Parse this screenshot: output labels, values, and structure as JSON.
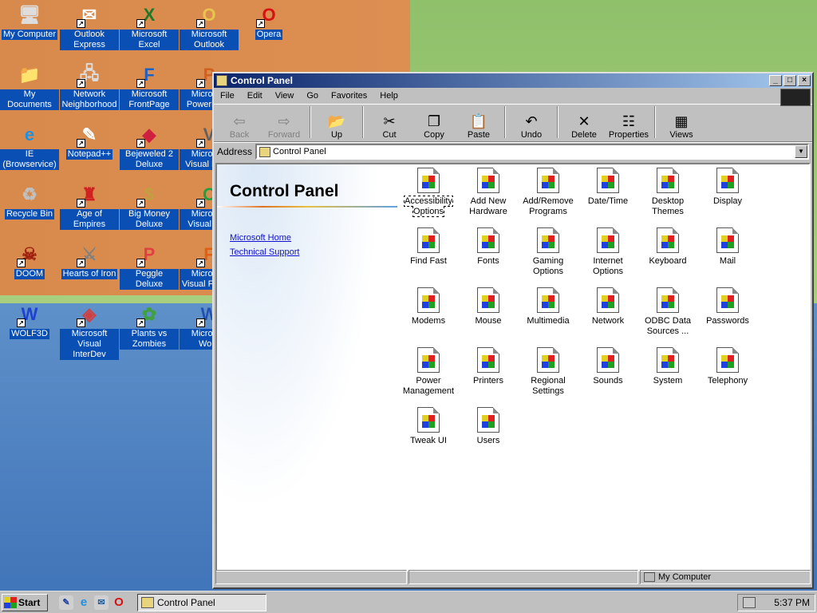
{
  "desktop": {
    "icons": [
      {
        "label": "My Computer",
        "glyph": "🖥",
        "color": "#dddddd"
      },
      {
        "label": "Outlook Express",
        "glyph": "✉",
        "color": "#ffffff"
      },
      {
        "label": "Microsoft Excel",
        "glyph": "X",
        "color": "#1e7a2a"
      },
      {
        "label": "Microsoft Outlook",
        "glyph": "O",
        "color": "#e8c44c"
      },
      {
        "label": "Opera",
        "glyph": "O",
        "color": "#d81010"
      },
      {
        "label": "My Documents",
        "glyph": "📁",
        "color": "#f0d060"
      },
      {
        "label": "Network Neighborhood",
        "glyph": "🖧",
        "color": "#dddddd"
      },
      {
        "label": "Microsoft FrontPage",
        "glyph": "F",
        "color": "#2060c0"
      },
      {
        "label": "Microsoft PowerPoint",
        "glyph": "P",
        "color": "#d06020"
      },
      {
        "label": "IE (Browservice)",
        "glyph": "e",
        "color": "#2090e0"
      },
      {
        "label": "Notepad++",
        "glyph": "✎",
        "color": "#ffffff"
      },
      {
        "label": "Bejeweled 2 Deluxe",
        "glyph": "◆",
        "color": "#d02040"
      },
      {
        "label": "Microsoft Visual Basic",
        "glyph": "V",
        "color": "#606060"
      },
      {
        "label": "Recycle Bin",
        "glyph": "♻",
        "color": "#c0c0c0"
      },
      {
        "label": "Age of Empires",
        "glyph": "♜",
        "color": "#d02020"
      },
      {
        "label": "Big Money Deluxe",
        "glyph": "$",
        "color": "#c0a040"
      },
      {
        "label": "Microsoft Visual C++",
        "glyph": "C",
        "color": "#20a040"
      },
      {
        "label": "DOOM",
        "glyph": "☠",
        "color": "#a02010"
      },
      {
        "label": "Hearts of Iron",
        "glyph": "⚔",
        "color": "#808080"
      },
      {
        "label": "Peggle Deluxe",
        "glyph": "P",
        "color": "#e04040"
      },
      {
        "label": "Microsoft Visual FoxPro",
        "glyph": "F",
        "color": "#e06010"
      },
      {
        "label": "WOLF3D",
        "glyph": "W",
        "color": "#2040d0"
      },
      {
        "label": "Microsoft Visual InterDev",
        "glyph": "◈",
        "color": "#d04040"
      },
      {
        "label": "Plants vs Zombies",
        "glyph": "✿",
        "color": "#40a040"
      },
      {
        "label": "Microsoft Word",
        "glyph": "W",
        "color": "#2050b0"
      }
    ]
  },
  "window": {
    "title": "Control Panel",
    "menu": [
      "File",
      "Edit",
      "View",
      "Go",
      "Favorites",
      "Help"
    ],
    "toolbar": [
      {
        "label": "Back",
        "glyph": "⇦",
        "disabled": true
      },
      {
        "label": "Forward",
        "glyph": "⇨",
        "disabled": true
      },
      {
        "label": "Up",
        "glyph": "📂",
        "disabled": false
      },
      {
        "label": "Cut",
        "glyph": "✂",
        "disabled": false
      },
      {
        "label": "Copy",
        "glyph": "❐",
        "disabled": false
      },
      {
        "label": "Paste",
        "glyph": "📋",
        "disabled": false
      },
      {
        "label": "Undo",
        "glyph": "↶",
        "disabled": false
      },
      {
        "label": "Delete",
        "glyph": "✕",
        "disabled": false
      },
      {
        "label": "Properties",
        "glyph": "☷",
        "disabled": false
      },
      {
        "label": "Views",
        "glyph": "▦",
        "disabled": false
      }
    ],
    "address_label": "Address",
    "address_value": "Control Panel",
    "left_title": "Control Panel",
    "links": [
      "Microsoft Home",
      "Technical Support"
    ],
    "items": [
      "Accessibility Options",
      "Add New Hardware",
      "Add/Remove Programs",
      "Date/Time",
      "Desktop Themes",
      "Display",
      "Find Fast",
      "Fonts",
      "Gaming Options",
      "Internet Options",
      "Keyboard",
      "Mail",
      "Modems",
      "Mouse",
      "Multimedia",
      "Network",
      "ODBC Data Sources ...",
      "Passwords",
      "Power Management",
      "Printers",
      "Regional Settings",
      "Sounds",
      "System",
      "Telephony",
      "Tweak UI",
      "Users"
    ],
    "status_right": "My Computer"
  },
  "taskbar": {
    "start_label": "Start",
    "task_label": "Control Panel",
    "clock": "5:37 PM"
  }
}
